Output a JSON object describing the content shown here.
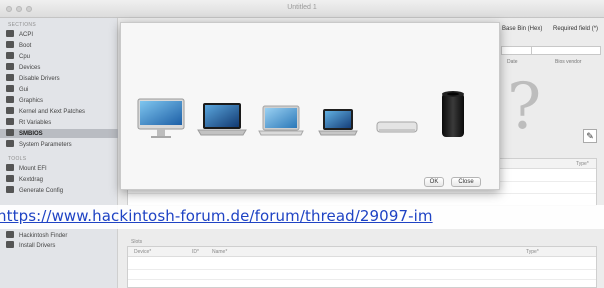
{
  "window": {
    "title": "Untitled 1"
  },
  "sidebar": {
    "section_sections": "SECTIONS",
    "section_tools": "TOOLS",
    "items": [
      {
        "label": "ACPI"
      },
      {
        "label": "Boot"
      },
      {
        "label": "Cpu"
      },
      {
        "label": "Devices"
      },
      {
        "label": "Disable Drivers"
      },
      {
        "label": "Gui"
      },
      {
        "label": "Graphics"
      },
      {
        "label": "Kernel and Kext Patches"
      },
      {
        "label": "Rt Variables"
      },
      {
        "label": "SMBIOS"
      },
      {
        "label": "System Parameters"
      }
    ],
    "selected_index": 9,
    "tools": [
      {
        "label": "Mount EFI"
      },
      {
        "label": "Kextdrag"
      },
      {
        "label": "Generate Config"
      },
      {
        "label": "Hackintosh Finder"
      },
      {
        "label": "Install Drivers"
      }
    ]
  },
  "header": {
    "col_base_bin": "Base Bin (Hex)",
    "col_required": "Required field (*)",
    "label_date": "Date",
    "label_vendor": "Bios vendor"
  },
  "tables": {
    "top": {
      "type_header": "Type*"
    },
    "bottom": {
      "group_label": "Slots",
      "headers": [
        "Device*",
        "ID*",
        "Name*",
        "Type*"
      ]
    }
  },
  "sheet": {
    "models": [
      "iMac",
      "MacBook Pro",
      "MacBook Air",
      "MacBook",
      "Mac mini",
      "Mac Pro"
    ],
    "ok_label": "OK",
    "close_label": "Close"
  },
  "overlay": {
    "url": "https://www.hackintosh-forum.de/forum/thread/29097-im"
  },
  "colors": {
    "link": "#1f43c4",
    "selected_row": "#b9bcc2"
  }
}
